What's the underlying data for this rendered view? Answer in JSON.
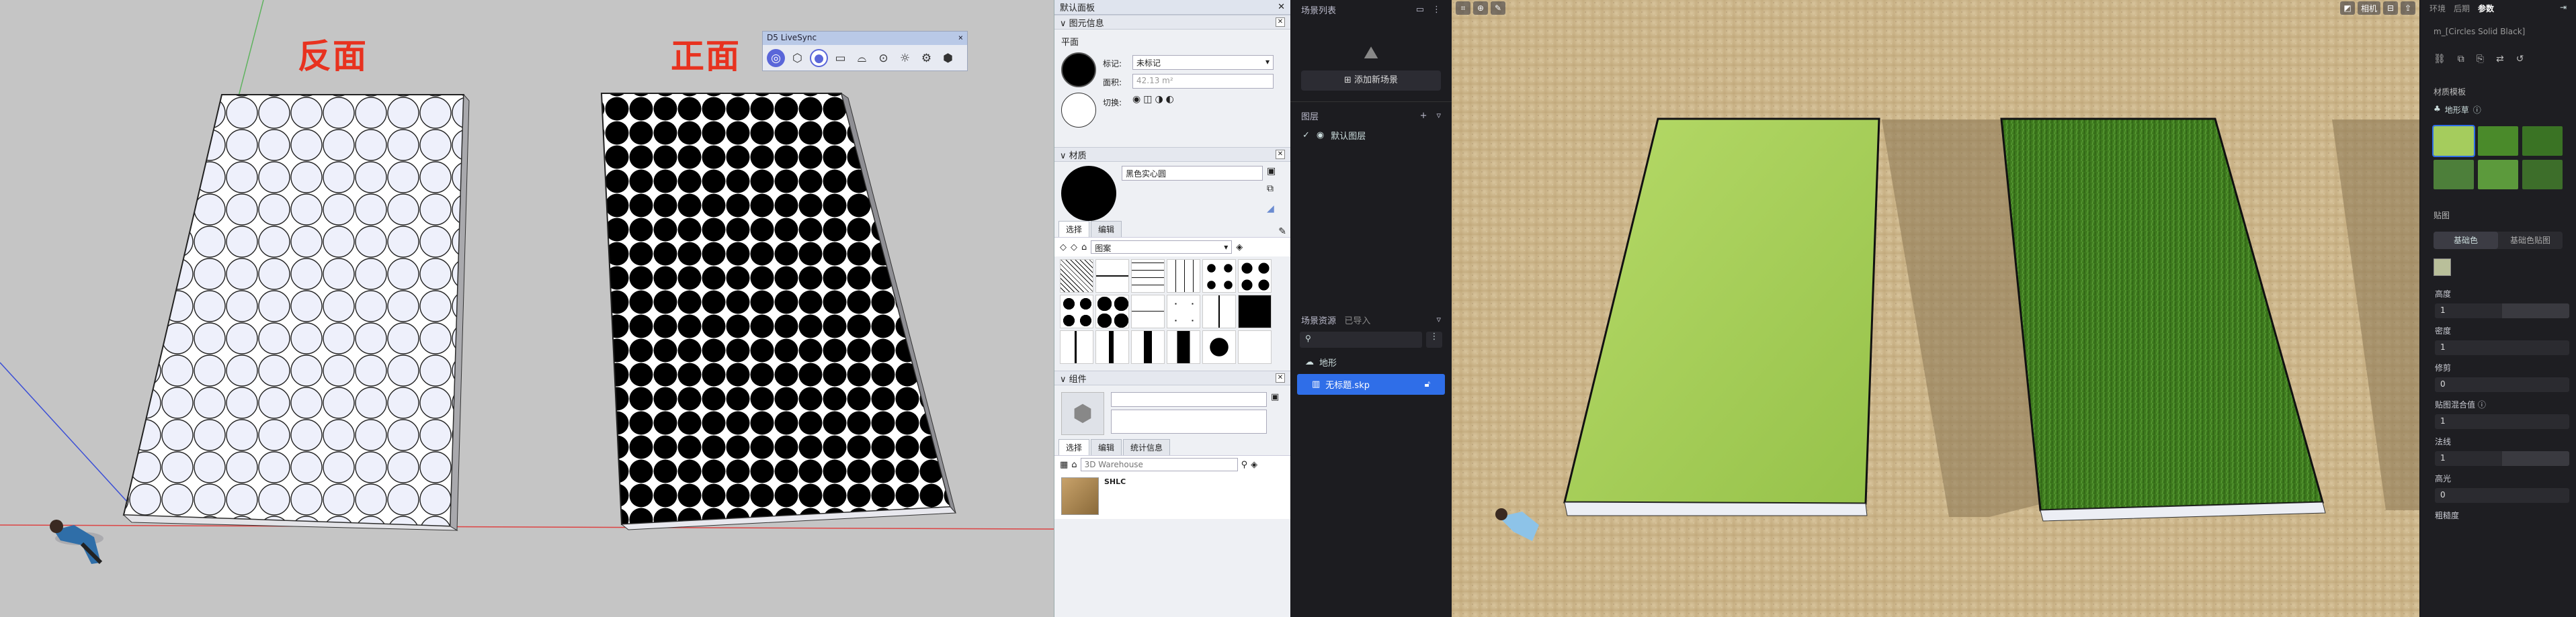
{
  "sketchup": {
    "label_back": "反面",
    "label_front": "正面",
    "livesync": {
      "title": "D5 LiveSync",
      "icons": [
        "d5-logo-icon",
        "cube-icon",
        "sync-icon",
        "camera-icon",
        "cap-icon",
        "settings-icon",
        "lightbulb-icon",
        "gear-icon",
        "box-icon"
      ]
    }
  },
  "tray": {
    "title": "默认面板",
    "entity_info": {
      "header": "图元信息",
      "type": "平面",
      "tag_label": "标记:",
      "tag_value": "未标记",
      "area_label": "面积:",
      "area_value": "42.13 m²",
      "shadow_label": "切换:"
    },
    "materials": {
      "header": "材质",
      "name": "黑色实心圆",
      "tab_select": "选择",
      "tab_edit": "编辑",
      "library": "图案"
    },
    "components": {
      "header": "组件",
      "tab_select": "选择",
      "tab_edit": "编辑",
      "tab_stats": "统计信息",
      "search_placeholder": "3D Warehouse",
      "item_name": "SHLC"
    }
  },
  "d5left": {
    "scene_list": "场景列表",
    "add_scene": "添加新场景",
    "layers": "图层",
    "default_layer": "默认图层",
    "scene_assets": "场景资源",
    "imported": "已导入",
    "asset_terrain": "地形",
    "asset_file": "无标题.skp"
  },
  "d5view": {
    "tool_left": "⌖",
    "tool_right": "相机"
  },
  "d5right": {
    "tabs": [
      "环境",
      "后期",
      "参数"
    ],
    "active_tab": "参数",
    "material_name": "m_[Circles Solid Black]",
    "section_template": "材质模板",
    "template_type": "地形草",
    "section_texture": "贴图",
    "tab_base_color": "基础色",
    "tab_base_map": "基础色贴图",
    "fields": [
      {
        "label": "高度",
        "value": "1"
      },
      {
        "label": "密度",
        "value": "1"
      },
      {
        "label": "修剪",
        "value": "0"
      },
      {
        "label": "贴图混合值",
        "value": "1"
      },
      {
        "label": "法线",
        "value": "1"
      },
      {
        "label": "高光",
        "value": "0"
      },
      {
        "label": "粗糙度",
        "value": ""
      }
    ]
  },
  "colors": {
    "accent_blue": "#2f6ee8",
    "red_label": "#e8321f",
    "grass_light": "#a7d05a",
    "grass_dark": "#3f7d1e"
  }
}
